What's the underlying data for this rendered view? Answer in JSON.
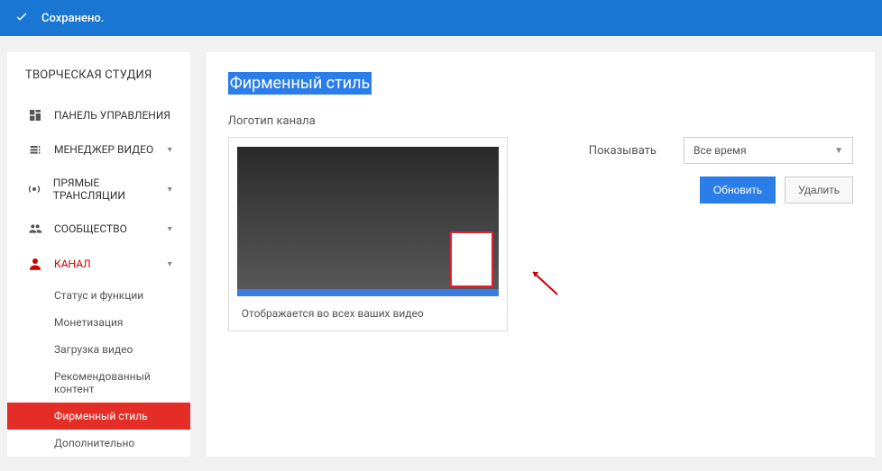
{
  "banner": {
    "message": "Сохранено."
  },
  "sidebar": {
    "title": "ТВОРЧЕСКАЯ СТУДИЯ",
    "items": [
      {
        "label": "ПАНЕЛЬ УПРАВЛЕНИЯ",
        "expandable": false
      },
      {
        "label": "МЕНЕДЖЕР ВИДЕО",
        "expandable": true
      },
      {
        "label": "ПРЯМЫЕ ТРАНСЛЯЦИИ",
        "expandable": true
      },
      {
        "label": "СООБЩЕСТВО",
        "expandable": true
      },
      {
        "label": "КАНАЛ",
        "expandable": true,
        "active": true
      }
    ],
    "channel_sub": [
      "Статус и функции",
      "Монетизация",
      "Загрузка видео",
      "Рекомендованный контент",
      "Фирменный стиль",
      "Дополнительно"
    ],
    "channel_sub_selected": 4
  },
  "main": {
    "heading": "Фирменный стиль",
    "section_label": "Логотип канала",
    "preview_caption": "Отображается во всех ваших видео",
    "display_label": "Показывать",
    "select_value": "Все время",
    "update_btn": "Обновить",
    "delete_btn": "Удалить"
  }
}
